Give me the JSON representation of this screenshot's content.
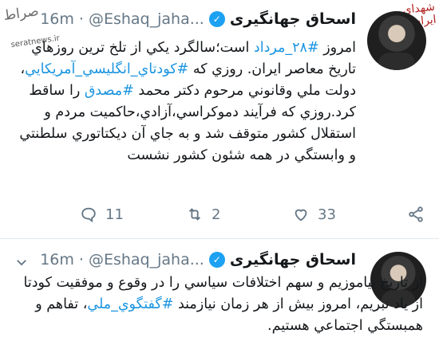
{
  "watermarks": {
    "left_logo_text": "صراط",
    "left_logo_url": "seratnews.ir",
    "right_logo_text": "شهدای ایران"
  },
  "tweets": [
    {
      "display_name": "اسحاق جهانگيرى",
      "verified_mark": "✓",
      "handle": "@Eshaq_jaha...",
      "dot": "·",
      "time": "16m",
      "text_runs": [
        {
          "text": "امروز ",
          "hashtag": false
        },
        {
          "text": "#۲۸_مرداد",
          "hashtag": true
        },
        {
          "text": " است؛سالگرد يكي از تلخ ترين روزهاي تاريخ معاصر ايران. روزي كه ",
          "hashtag": false
        },
        {
          "text": "#كودتاي_انگليسي_آمريكايي",
          "hashtag": true
        },
        {
          "text": "، دولت ملي وقانوني مرحوم دكتر محمد ",
          "hashtag": false
        },
        {
          "text": "#مصدق",
          "hashtag": true
        },
        {
          "text": " را ساقط كرد.روزي كه فرآيند دموكراسي،آزادي،حاكميت مردم و استقلال كشور متوقف شد و به جاي آن ديكتاتوري سلطنتي و وابستگي در همه شئون كشور نشست",
          "hashtag": false
        }
      ],
      "actions": {
        "reply_count": "11",
        "retweet_count": "2",
        "like_count": "33"
      }
    },
    {
      "display_name": "اسحاق جهانگيرى",
      "verified_mark": "✓",
      "handle": "@Eshaq_jaha...",
      "dot": "·",
      "time": "16m",
      "text_runs": [
        {
          "text": "از تاريخ بياموزيم و سهم اختلافات سياسي را در وقوع و موفقيت كودتا از ياد نبريم، امروز بيش از هر زمان نيازمند ",
          "hashtag": false
        },
        {
          "text": "#گفتگوي_ملي",
          "hashtag": true
        },
        {
          "text": "، تفاهم و همبستگي اجتماعي هستيم.",
          "hashtag": false
        }
      ]
    }
  ]
}
